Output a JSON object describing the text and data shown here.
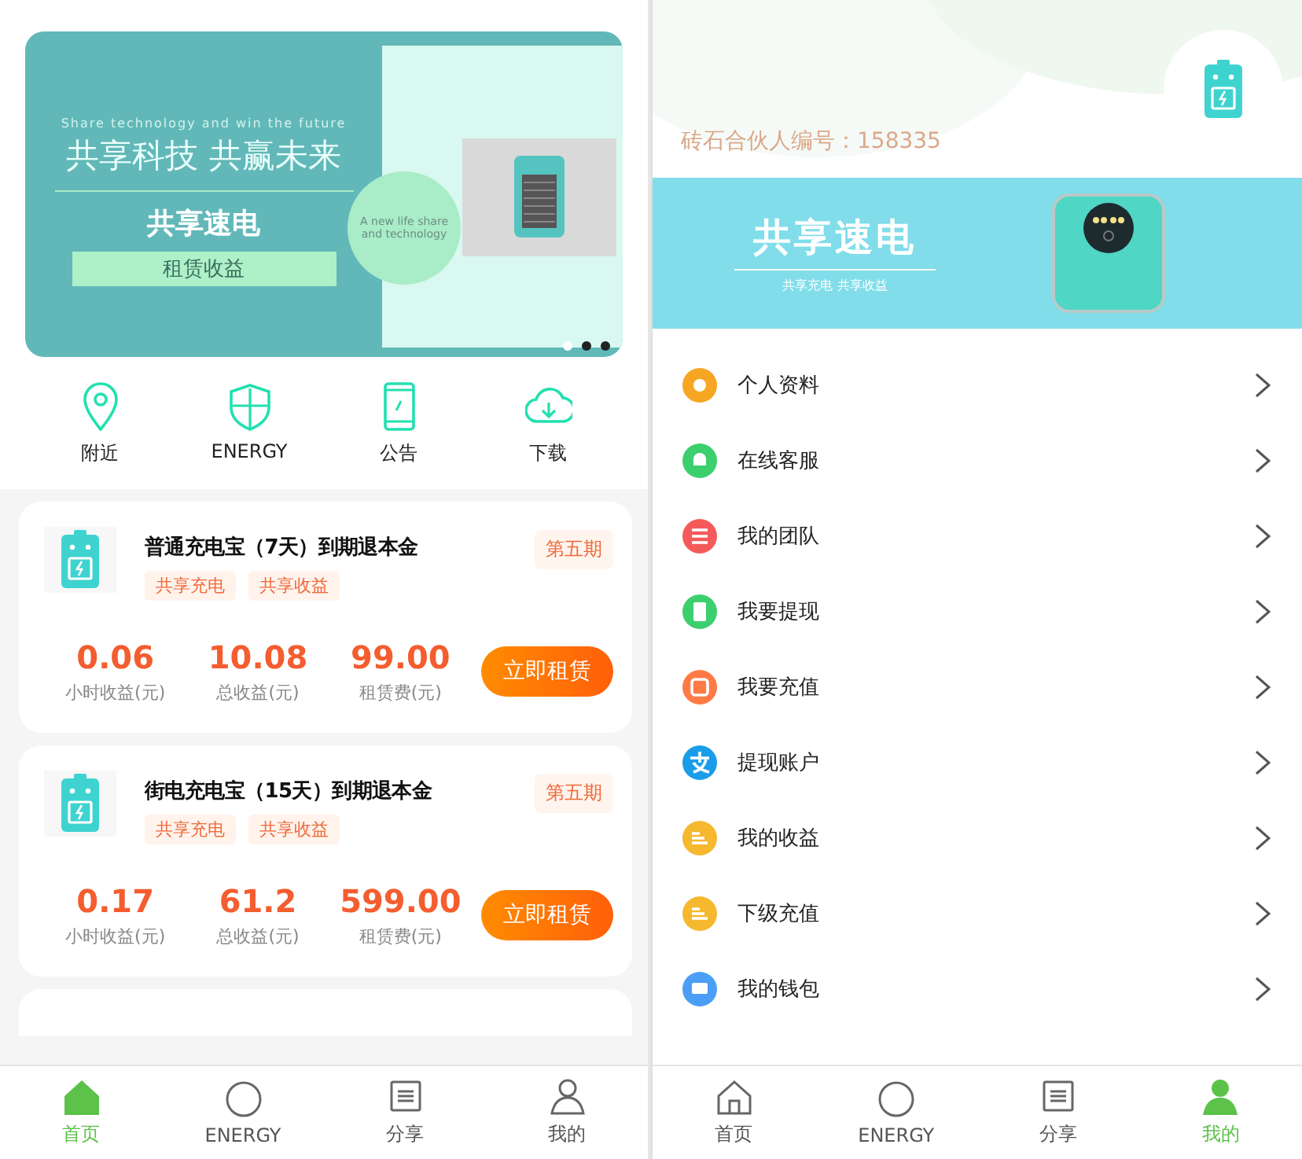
{
  "home": {
    "banner": {
      "tagline": "Share technology and win the future",
      "headline": "共享科技 共赢未来",
      "title": "共享速电",
      "ribbon": "租赁收益",
      "circle_text": "A new life share and technology"
    },
    "shortcuts": [
      {
        "label": "附近",
        "kind": "pin"
      },
      {
        "label": "ENERGY",
        "kind": "shield"
      },
      {
        "label": "公告",
        "kind": "phone"
      },
      {
        "label": "下载",
        "kind": "cloud"
      }
    ],
    "products": [
      {
        "title": "普通充电宝（7天）到期退本金",
        "tags": [
          "共享充电",
          "共享收益"
        ],
        "period": "第五期",
        "stats": [
          {
            "value": "0.06",
            "label": "小时收益(元)"
          },
          {
            "value": "10.08",
            "label": "总收益(元)"
          },
          {
            "value": "99.00",
            "label": "租赁费(元)"
          }
        ],
        "button": "立即租赁"
      },
      {
        "title": "街电充电宝（15天）到期退本金",
        "tags": [
          "共享充电",
          "共享收益"
        ],
        "period": "第五期",
        "stats": [
          {
            "value": "0.17",
            "label": "小时收益(元)"
          },
          {
            "value": "61.2",
            "label": "总收益(元)"
          },
          {
            "value": "599.00",
            "label": "租赁费(元)"
          }
        ],
        "button": "立即租赁"
      }
    ],
    "tabs": [
      {
        "label": "首页",
        "kind": "home",
        "selected": true
      },
      {
        "label": "ENERGY",
        "kind": "circle",
        "selected": false
      },
      {
        "label": "分享",
        "kind": "ticket",
        "selected": false
      },
      {
        "label": "我的",
        "kind": "person",
        "selected": false
      }
    ]
  },
  "mine": {
    "partner_id": "砖石合伙人编号：158335",
    "promo": {
      "title": "共享速电",
      "subtitle": "共享充电 共享收益"
    },
    "menu": [
      {
        "label": "个人资料",
        "kind": "gear",
        "color": "#f7a623"
      },
      {
        "label": "在线客服",
        "kind": "bell",
        "color": "#3ccf6e"
      },
      {
        "label": "我的团队",
        "kind": "list",
        "color": "#f55a5a"
      },
      {
        "label": "我要提现",
        "kind": "book",
        "color": "#3ccf6e"
      },
      {
        "label": "我要充值",
        "kind": "phone",
        "color": "#ff7a45"
      },
      {
        "label": "提现账户",
        "kind": "pay",
        "color": "#1a9de8"
      },
      {
        "label": "我的收益",
        "kind": "bars",
        "color": "#f5b82e"
      },
      {
        "label": "下级充值",
        "kind": "bars",
        "color": "#f5b82e"
      },
      {
        "label": "我的钱包",
        "kind": "card",
        "color": "#4a9ef5"
      }
    ],
    "tabs": [
      {
        "label": "首页",
        "kind": "home",
        "selected": false
      },
      {
        "label": "ENERGY",
        "kind": "circle",
        "selected": false
      },
      {
        "label": "分享",
        "kind": "ticket",
        "selected": false
      },
      {
        "label": "我的",
        "kind": "person",
        "selected": true
      }
    ]
  }
}
